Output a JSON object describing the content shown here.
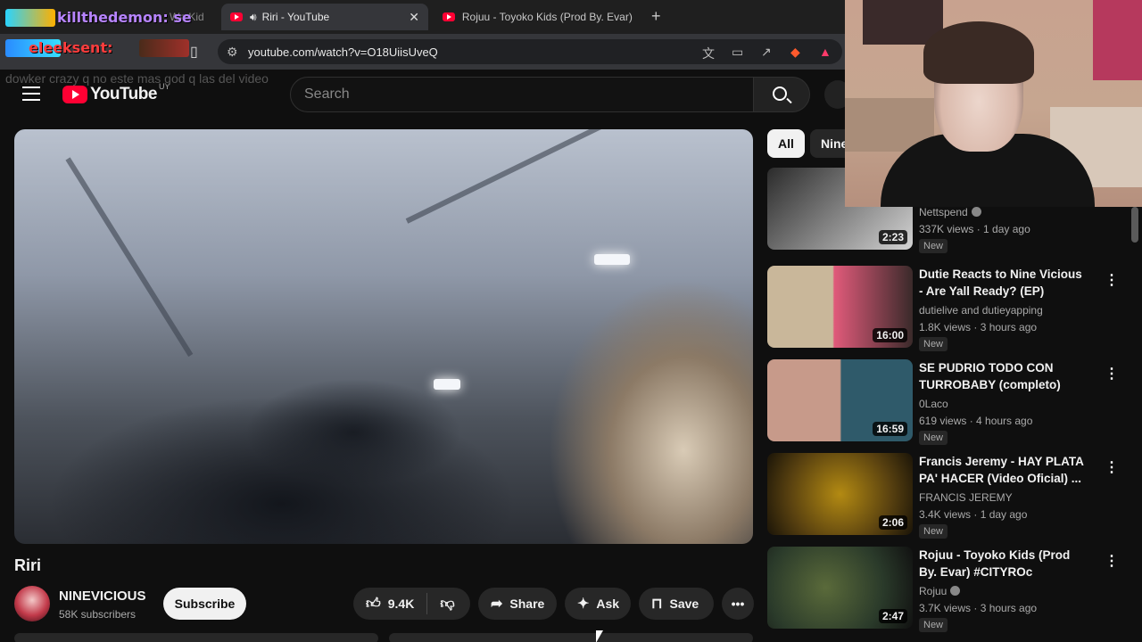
{
  "browser": {
    "tabs": [
      {
        "label": "killthedemon: se",
        "muted_suffix": "Wn Kid"
      },
      {
        "label": "Riri - YouTube",
        "active": true
      },
      {
        "label": "Rojuu - Toyoko Kids (Prod By. Evar) #"
      }
    ],
    "url": "youtube.com/watch?v=O18UiisUveQ"
  },
  "overlay": {
    "chat_user1": "killthedemon: se",
    "chat_user2": "eleeksent:",
    "faded_chat": "dowker crazy q no este mas god q las del video"
  },
  "youtube": {
    "logo_text": "YouTube",
    "country_code": "UY",
    "search_placeholder": "Search"
  },
  "video": {
    "title": "Riri",
    "channel": "NINEVICIOUS",
    "subscribers": "58K subscribers",
    "subscribe_label": "Subscribe",
    "likes": "9.4K",
    "share_label": "Share",
    "ask_label": "Ask",
    "save_label": "Save"
  },
  "chips": [
    "All",
    "Nine"
  ],
  "recommendations": [
    {
      "channel": "Nettspend",
      "verified": true,
      "stats": "337K views · 1 day ago",
      "badge": "New",
      "duration": "2:23",
      "thumb": [
        "#2b2b2b",
        "#d3d3d3"
      ]
    },
    {
      "title": "Dutie Reacts to Nine Vicious - Are Yall Ready? (EP)",
      "channel": "dutielive and dutieyapping",
      "stats": "1.8K views · 3 hours ago",
      "badge": "New",
      "duration": "16:00",
      "thumb": [
        "#c9b79a",
        "#e05a7a"
      ]
    },
    {
      "title": "SE PUDRIO TODO CON TURROBABY (completo)",
      "channel": "0Laco",
      "stats": "619 views · 4 hours ago",
      "badge": "New",
      "duration": "16:59",
      "thumb": [
        "#c79a8a",
        "#2f5a6a"
      ]
    },
    {
      "title": "Francis Jeremy - HAY PLATA PA' HACER (Video Oficial) ...",
      "channel": "FRANCIS JEREMY",
      "stats": "3.4K views · 1 day ago",
      "badge": "New",
      "duration": "2:06",
      "thumb": [
        "#b38a12",
        "#3a2a10"
      ]
    },
    {
      "title": "Rojuu - Toyoko Kids (Prod By. Evar) #CITYROc",
      "channel": "Rojuu",
      "verified": true,
      "stats": "3.7K views · 3 hours ago",
      "badge": "New",
      "duration": "2:47",
      "thumb": [
        "#5a6a3a",
        "#1a2a1a"
      ]
    }
  ]
}
